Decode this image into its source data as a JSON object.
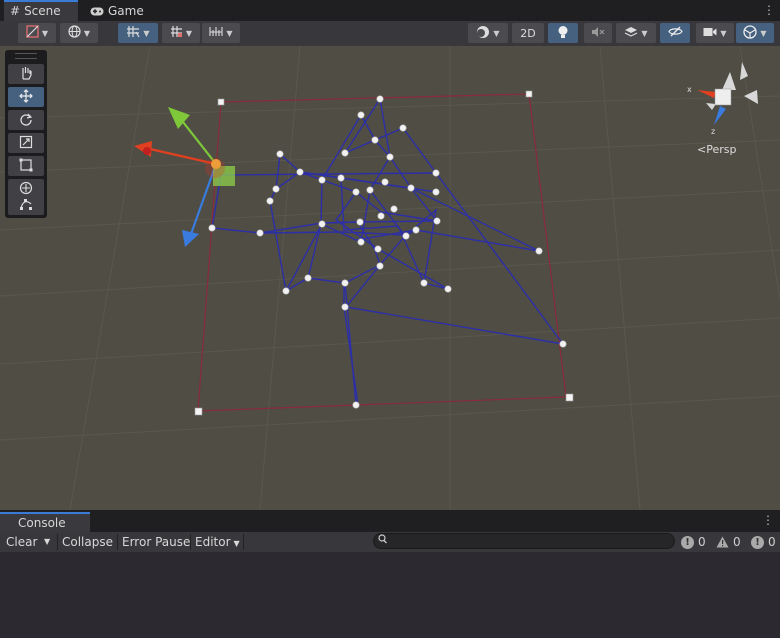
{
  "tabs": {
    "scene": "Scene",
    "game": "Game",
    "scene_icon": "grid-icon",
    "game_icon": "gamepad-icon"
  },
  "toolbar": {
    "mode_2d": "2D"
  },
  "scene": {
    "camera_mode": "Persp",
    "axis_x": "x",
    "axis_z": "z"
  },
  "console": {
    "tab_label": "Console",
    "clear": "Clear",
    "collapse": "Collapse",
    "error_pause": "Error Pause",
    "editor": "Editor",
    "search_value": "",
    "info_count": "0",
    "warning_count": "0",
    "error_count": "0"
  },
  "colors": {
    "wire_blue": "#2d2fa8",
    "frame_red": "#8a2a3c",
    "accent": "#3a7bd5",
    "gizmo_x": "#e0401f",
    "gizmo_y": "#7ec83a",
    "gizmo_z": "#3a7be0"
  }
}
